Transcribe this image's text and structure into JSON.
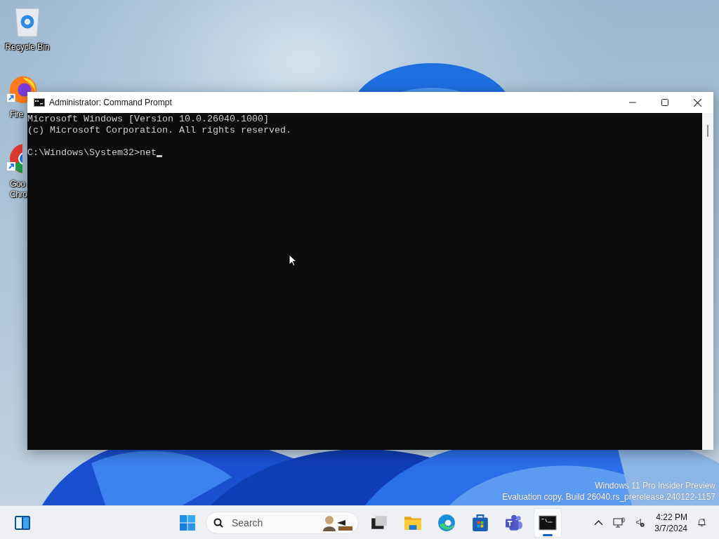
{
  "desktop_icons": [
    {
      "kind": "recycle",
      "lines": [
        "Recycle Bin"
      ]
    },
    {
      "kind": "firefox",
      "lines": [
        "Fire"
      ]
    },
    {
      "kind": "chrome",
      "lines": [
        "Goo",
        "Chro"
      ]
    }
  ],
  "window": {
    "title": "Administrator: Command Prompt",
    "console": {
      "lines": [
        "Microsoft Windows [Version 10.0.26040.1000]",
        "(c) Microsoft Corporation. All rights reserved."
      ],
      "prompt": "C:\\Windows\\System32>net"
    }
  },
  "watermark": [
    "Windows 11 Pro Insider Preview",
    "Evaluation copy. Build 26040.rs_prerelease.240122-1157"
  ],
  "taskbar": {
    "search": {
      "placeholder": "Search"
    },
    "apps": [
      {
        "kind": "taskview",
        "selected": false
      },
      {
        "kind": "explorer",
        "selected": false
      },
      {
        "kind": "edge",
        "selected": false
      },
      {
        "kind": "store",
        "selected": false
      },
      {
        "kind": "teams",
        "selected": false
      },
      {
        "kind": "terminal",
        "selected": true
      }
    ],
    "clock": {
      "time": "4:22 PM",
      "date": "3/7/2024"
    }
  }
}
